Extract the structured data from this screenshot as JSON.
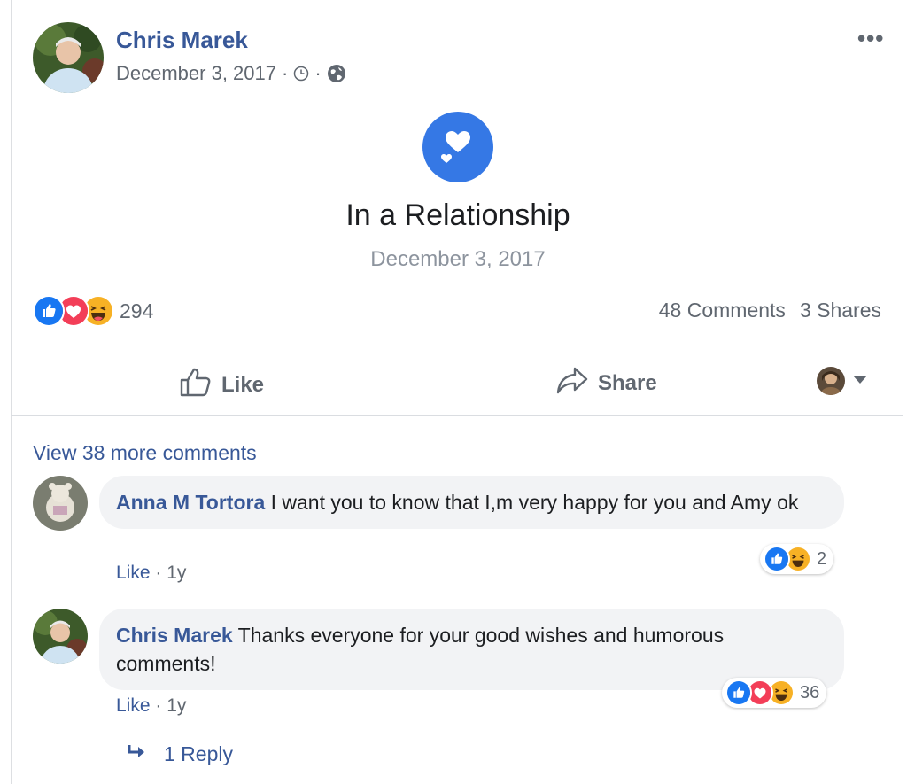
{
  "post": {
    "author": "Chris Marek",
    "date": "December 3, 2017",
    "meta_sep": "·",
    "more_label": "•••",
    "event_title": "In a Relationship",
    "event_date": "December 3, 2017",
    "event_icon": "hearts-icon",
    "reaction_icons": [
      "like-reaction-icon",
      "love-reaction-icon",
      "haha-reaction-icon"
    ],
    "reaction_count": "294",
    "comments_count": "48 Comments",
    "shares_count": "3 Shares"
  },
  "actions": {
    "like_label": "Like",
    "share_label": "Share"
  },
  "comments": {
    "view_more": "View 38 more comments",
    "items": [
      {
        "name": "Anna M Tortora",
        "text": "I want you to know that I,m very happy for you and Amy ok",
        "like": "Like",
        "sep": "·",
        "time": "1y",
        "reaction_count": "2"
      },
      {
        "name": "Chris Marek",
        "text": "Thanks everyone for your good wishes and humorous comments!",
        "like": "Like",
        "sep": "·",
        "time": "1y",
        "reaction_count": "36"
      }
    ],
    "reply_label": "1 Reply"
  },
  "colors": {
    "link": "#385898",
    "meta": "#606770",
    "event_blue": "#3578e5",
    "like_blue": "#1877f2",
    "love_red": "#f33e58",
    "haha_yellow": "#f7b125"
  }
}
